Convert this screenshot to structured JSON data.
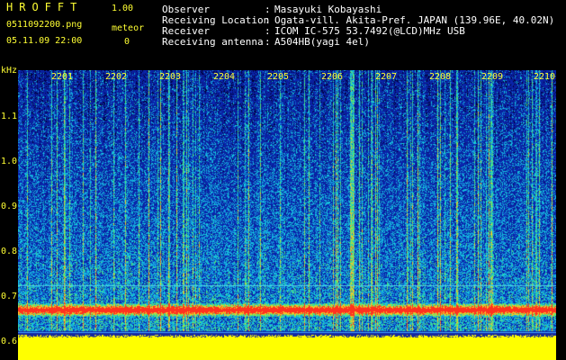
{
  "header": {
    "app_title": "HROFFT",
    "app_version": "1.00",
    "file_name": "0511092200.png",
    "meteor_label": "meteor",
    "datetime": "05.11.09 22:00",
    "meteor_count": "0"
  },
  "info": [
    {
      "label": "Observer",
      "value": "Masayuki Kobayashi"
    },
    {
      "label": "Receiving Location",
      "value": "Ogata-vill. Akita-Pref. JAPAN (139.96E, 40.02N)"
    },
    {
      "label": "Receiver",
      "value": "ICOM IC-575 53.7492(@LCD)MHz USB"
    },
    {
      "label": "Receiving antenna",
      "value": "A504HB(yagi 4el)"
    }
  ],
  "axis": {
    "unit": "kHz",
    "y_ticks": [
      "1.1",
      "1.0",
      "0.9",
      "0.8",
      "0.7",
      "0.6"
    ],
    "time_ticks": [
      "2201",
      "2202",
      "2203",
      "2204",
      "2205",
      "2206",
      "2207",
      "2208",
      "2209",
      "2210"
    ]
  },
  "colors": {
    "label_text": "#ffff33",
    "background": "#000000",
    "noise_floor": "#0a1a8c",
    "signal_band": "#ff3322",
    "guide_line": "#4dd0e1",
    "baseline_band": "#ffff00"
  }
}
